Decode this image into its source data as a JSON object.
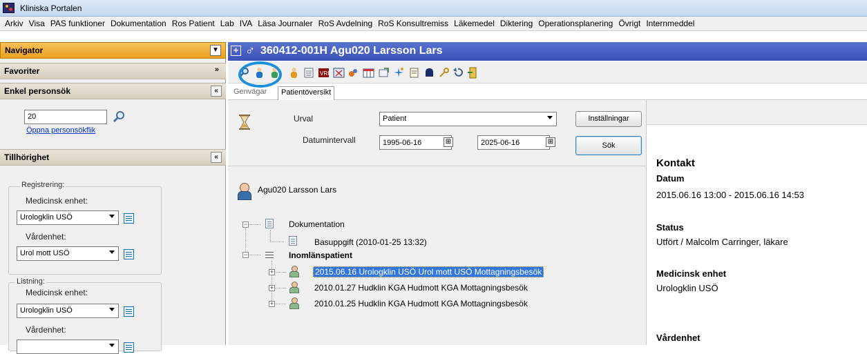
{
  "window": {
    "title": "Kliniska Portalen"
  },
  "menu": [
    "Arkiv",
    "Visa",
    "PAS funktioner",
    "Dokumentation",
    "Ros Patient",
    "Lab",
    "IVA",
    "Läsa Journaler",
    "RoS Avdelning",
    "RoS Konsultremiss",
    "Läkemedel",
    "Diktering",
    "Operationsplanering",
    "Övrigt",
    "Internmeddel"
  ],
  "navigator": {
    "title": "Navigator",
    "favorites": "Favoriter",
    "search_section": "Enkel personsök",
    "search_value": "20",
    "open_link": "Öppna personsökflik",
    "affiliation_section": "Tillhörighet",
    "registration": {
      "legend": "Registrering:",
      "med_unit_label": "Medicinsk enhet:",
      "med_unit_value": "Urologklin USÖ",
      "care_unit_label": "Vårdenhet:",
      "care_unit_value": "Urol mott USÖ"
    },
    "listing": {
      "legend": "Listning:",
      "med_unit_label": "Medicinsk enhet:",
      "med_unit_value": "Urologklin USÖ",
      "care_unit_label": "Vårdenhet:"
    }
  },
  "patient": {
    "id_name": "360412-001H  Agu020 Larsson Lars",
    "gender_symbol": "♂"
  },
  "tabs": [
    "Genvägar",
    "Patientöversikt"
  ],
  "filter": {
    "urval_label": "Urval",
    "urval_value": "Patient",
    "date_label": "Datumintervall",
    "date_from": "1995-06-16",
    "date_to": "2025-06-16",
    "settings_button": "Inställningar",
    "search_button": "Sök"
  },
  "tree": {
    "patient_name": "Agu020 Larsson Lars",
    "documentation": "Dokumentation",
    "base_info": "Basuppgift (2010-01-25 13:32)",
    "inpatient": "Inomlänspatient",
    "visits": [
      "2015.06.16 Urologklin USÖ Urol mott USÖ Mottagningsbesök",
      "2010.01.27 Hudklin  KGA Hudmott KGA Mottagningsbesök",
      "2010.01.25 Hudklin  KGA Hudmott KGA Mottagningsbesök"
    ]
  },
  "contact": {
    "title": "Kontakt",
    "date_label": "Datum",
    "date_value": "2015.06.16 13:00 - 2015.06.16 14:53",
    "status_label": "Status",
    "status_value": "Utfört / Malcolm Carringer, läkare",
    "med_unit_label": "Medicinsk enhet",
    "med_unit_value": "Urologklin USÖ",
    "care_unit_label": "Vårdenhet"
  },
  "icons": {
    "app": "app-icon",
    "search": "magnifier-icon",
    "hourglass": "hourglass-icon",
    "calendar": "calendar-icon"
  },
  "colors": {
    "navigator_header": "#eaa020",
    "patient_header": "#3b52b8",
    "selection": "#3377dd",
    "highlight_ring": "#1a8fdc"
  }
}
